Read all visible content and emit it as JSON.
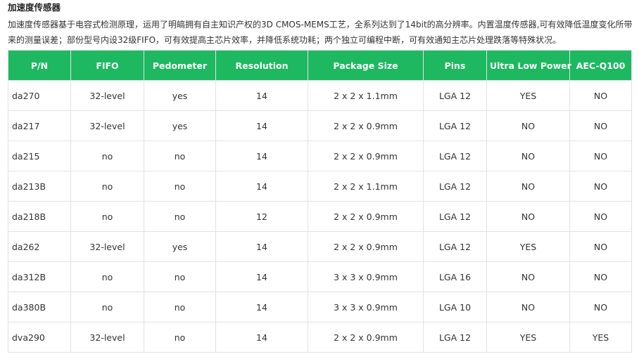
{
  "page": {
    "title": "加速度传感器",
    "description": "加速度传感器基于电容式检测原理，运用了明皜拥有自主知识产权的3D CMOS-MEMS工艺，全系列达到了14bit的高分辨率。内置温度传感器,可有效降低温度变化所带来的测量误差；部份型号内设32级FIFO，可有效提高主芯片效率，并降低系统功耗；两个独立可编程中断，可有效通知主芯片处理跌落等特殊状况。"
  },
  "table": {
    "columns": [
      "P/N",
      "FIFO",
      "Pedometer",
      "Resolution",
      "Package Size",
      "Pins",
      "Ultra Low Power",
      "AEC-Q100"
    ],
    "rows": [
      [
        "da270",
        "32-level",
        "yes",
        "14",
        "2 x 2 x 1.1mm",
        "LGA 12",
        "YES",
        "NO"
      ],
      [
        "da217",
        "32-level",
        "yes",
        "14",
        "2 x 2 x 0.9mm",
        "LGA 12",
        "NO",
        "NO"
      ],
      [
        "da215",
        "no",
        "no",
        "14",
        "2 x 2 x 0.9mm",
        "LGA 12",
        "NO",
        "NO"
      ],
      [
        "da213B",
        "no",
        "no",
        "14",
        "2 x 2 x 1.1mm",
        "LGA 12",
        "NO",
        "NO"
      ],
      [
        "da218B",
        "no",
        "no",
        "12",
        "2 x 2 x 0.9mm",
        "LGA 12",
        "NO",
        "NO"
      ],
      [
        "da262",
        "32-level",
        "yes",
        "14",
        "2 x 2 x 0.9mm",
        "LGA 12",
        "YES",
        "NO"
      ],
      [
        "da312B",
        "no",
        "no",
        "14",
        "3 x 3 x 0.9mm",
        "LGA 16",
        "NO",
        "NO"
      ],
      [
        "da380B",
        "no",
        "no",
        "14",
        "3 x 3 x 0.9mm",
        "LGA 10",
        "NO",
        "NO"
      ],
      [
        "dva290",
        "32-level",
        "no",
        "14",
        "2 x 2 x 0.9mm",
        "LGA 12",
        "YES",
        "YES"
      ]
    ]
  },
  "colors": {
    "header_bg": "#1db860",
    "header_text": "#ffffff",
    "border": "#e3e3e3",
    "body_text": "#333333"
  }
}
